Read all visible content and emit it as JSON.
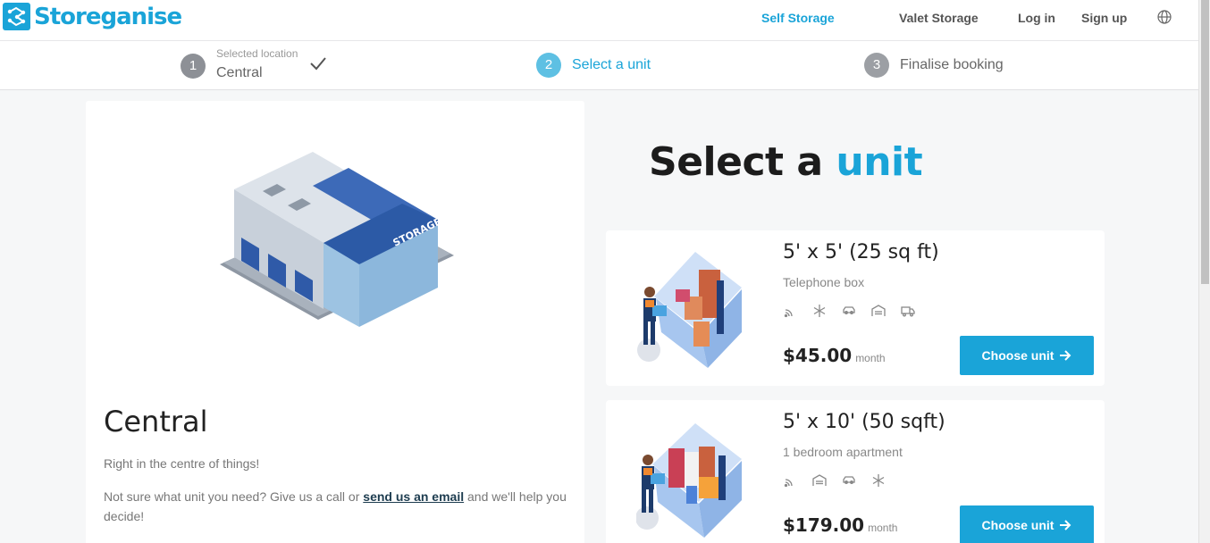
{
  "brand": {
    "name": "Storeganise",
    "color": "#1aa4d8"
  },
  "nav": {
    "self_storage": "Self Storage",
    "valet_storage": "Valet Storage",
    "login": "Log in",
    "signup": "Sign up",
    "language_icon": "globe-icon"
  },
  "stepper": {
    "steps": [
      {
        "number": "1",
        "small_label": "Selected location",
        "label": "Central",
        "status": "done"
      },
      {
        "number": "2",
        "label": "Select a unit",
        "status": "current"
      },
      {
        "number": "3",
        "label": "Finalise booking",
        "status": "todo"
      }
    ]
  },
  "location": {
    "name": "Central",
    "description": "Right in the centre of things!",
    "help_prefix": "Not sure what unit you need? Give us a call or ",
    "help_link": "send us an email",
    "help_suffix": " and we'll help you decide!",
    "more_text": "..."
  },
  "heading": {
    "prefix": "Select a ",
    "accent": "unit"
  },
  "units": [
    {
      "name": "5' x 5' (25 sq ft)",
      "subtitle": "Telephone box",
      "features": [
        "wifi-icon",
        "snowflake-icon",
        "car-icon",
        "garage-icon",
        "truck-icon"
      ],
      "price": "$45.00",
      "period": "month",
      "button": "Choose unit"
    },
    {
      "name": "5' x 10' (50 sqft)",
      "subtitle": "1 bedroom apartment",
      "features": [
        "wifi-icon",
        "garage-icon",
        "car-icon",
        "snowflake-icon"
      ],
      "price": "$179.00",
      "period": "month",
      "button": "Choose unit"
    }
  ]
}
